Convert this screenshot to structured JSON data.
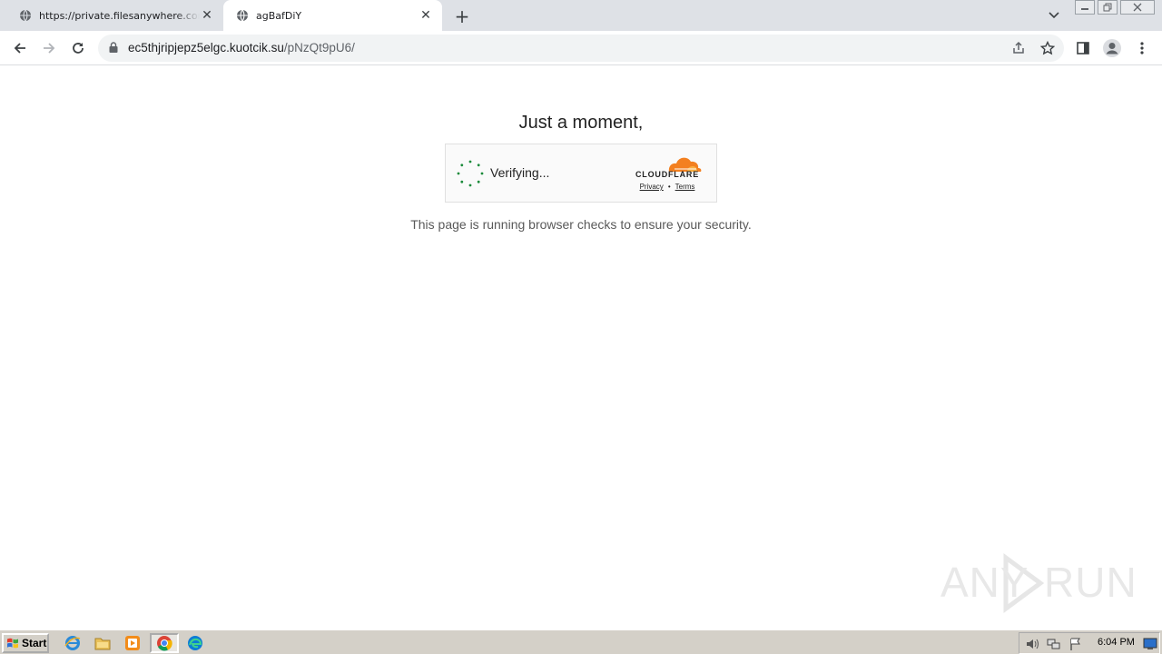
{
  "browser": {
    "tabs": [
      {
        "title": "https://private.filesanywhere.com/g",
        "active": false
      },
      {
        "title": "agBafDiY",
        "active": true
      }
    ],
    "new_tab_symbol": "+",
    "close_symbol": "✕",
    "address": {
      "host": "ec5thjripjepz5elgc.kuotcik.su",
      "path": "/pNzQt9pU6/"
    },
    "icons": [
      "globe-icon",
      "back-arrow-icon",
      "forward-arrow-icon",
      "reload-icon",
      "lock-icon",
      "share-icon",
      "bookmark-star-icon",
      "side-panel-icon",
      "profile-icon",
      "menu-kebab-icon"
    ]
  },
  "page": {
    "heading": "Just a moment,",
    "widget": {
      "status": "Verifying...",
      "brand": "CLOUDFLARE",
      "privacy_link": "Privacy",
      "separator": "•",
      "terms_link": "Terms",
      "brand_color": "#f38020",
      "spinner_color": "#1a8a3a"
    },
    "subtext": "This page is running browser checks to ensure your security.",
    "watermark": "ANY RUN"
  },
  "taskbar": {
    "start_label": "Start",
    "apps": [
      "internet-explorer-icon",
      "folder-icon",
      "media-player-icon",
      "chrome-icon",
      "edge-icon"
    ],
    "clock": "6:04 PM"
  }
}
